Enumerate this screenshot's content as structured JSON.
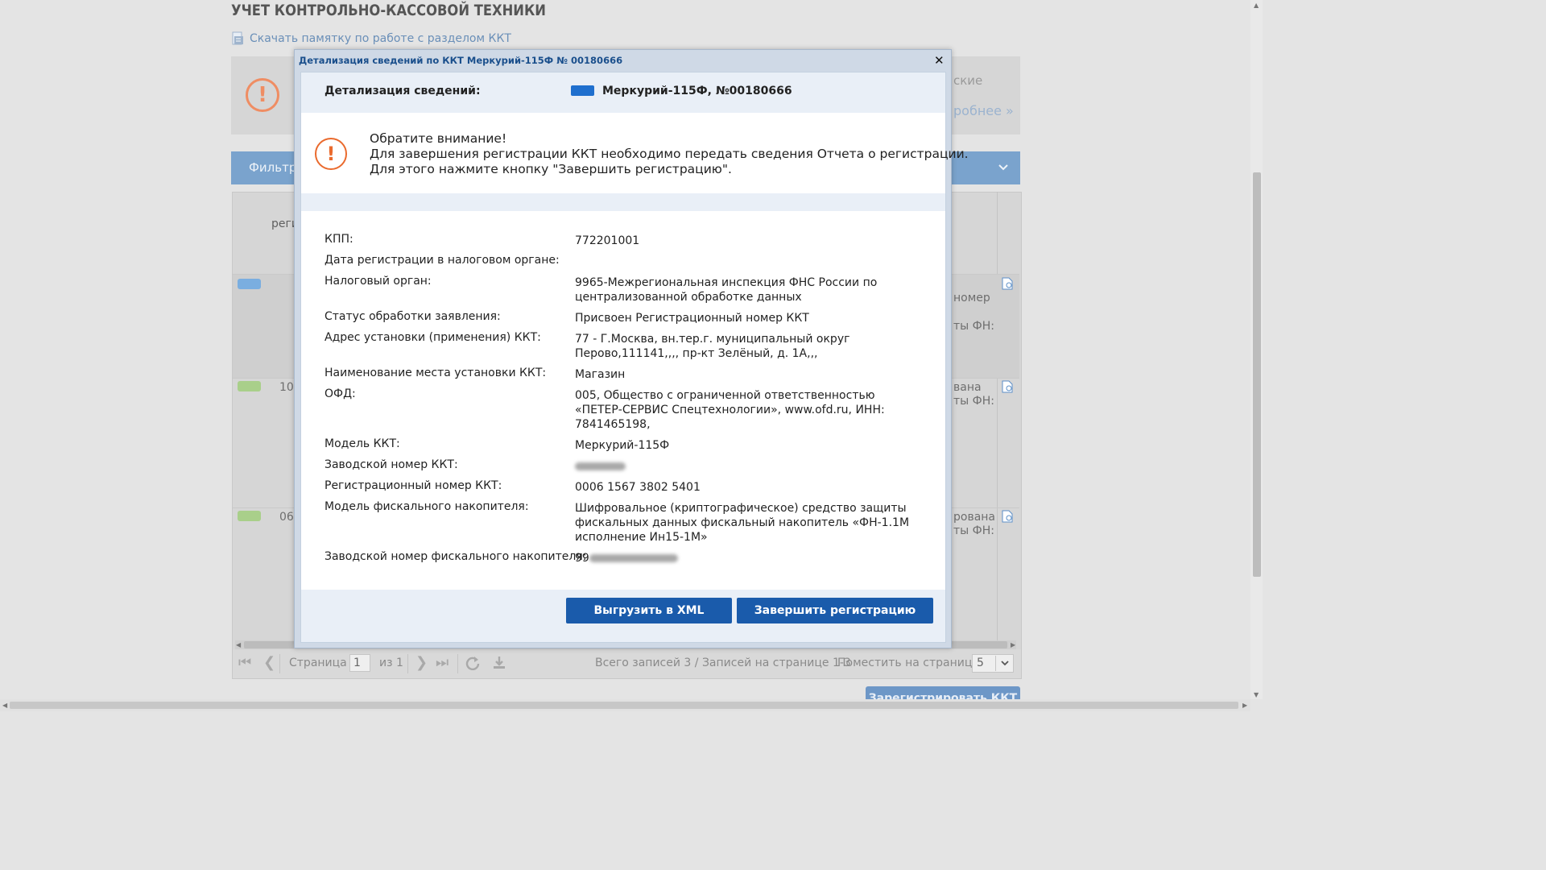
{
  "page": {
    "title": "УЧЕТ КОНТРОЛЬНО-КАССОВОЙ ТЕХНИКИ",
    "memo_link": "Скачать памятку по работе с разделом ККТ",
    "notice_fragment_1": "ские",
    "notice_fragment_2": "робнее »",
    "filter_label": "Фильтр",
    "grid_header_label": "реги",
    "rows": [
      {
        "date": "",
        "status_1": "номер",
        "status_2": "ты ФН:",
        "swatch_color": "#7aaee0"
      },
      {
        "date": "10.",
        "status_1": "вана",
        "status_2": "ты ФН:",
        "swatch_color": "#a9cf8a"
      },
      {
        "date": "06.",
        "status_1": "рована",
        "status_2": "ты ФН:",
        "swatch_color": "#a9cf8a"
      }
    ],
    "pager": {
      "first": "⏮",
      "prev": "❮",
      "page_label": "Страница",
      "page_value": "1",
      "of_label": "из 1",
      "next": "❯",
      "last": "⏭",
      "summary": "Всего записей 3 / Записей на странице 1-3",
      "per_page_label": "Поместить на страницу:",
      "per_page_value": "5"
    },
    "register_button": "Зарегистрировать ККТ"
  },
  "modal": {
    "title": "Детализация сведений по ККТ Меркурий-115Ф № 00180666",
    "close_glyph": "✕",
    "section_label": "Детализация сведений:",
    "section_value": "Меркурий-115Ф, №00180666",
    "kkt_color": "#1f6fce",
    "attention": {
      "line1": "Обратите внимание!",
      "line2": "Для завершения регистрации ККТ необходимо передать сведения Отчета о регистрации.",
      "line3": "Для этого нажмите кнопку \"Завершить регистрацию\"."
    },
    "fields": [
      {
        "label": "КПП:",
        "value": [
          "772201001"
        ]
      },
      {
        "label": "Дата регистрации в налоговом органе:",
        "value": [
          ""
        ]
      },
      {
        "label": "Налоговый орган:",
        "value": [
          "9965-Межрегиональная инспекция ФНС России по",
          "централизованной обработке данных"
        ]
      },
      {
        "label": "Статус обработки заявления:",
        "value": [
          "Присвоен Регистрационный номер ККТ"
        ]
      },
      {
        "label": "Адрес установки (применения) ККТ:",
        "value": [
          "77 - Г.Москва, вн.тер.г. муниципальный округ",
          "Перово,111141,,,, пр-кт Зелёный, д. 1А,,,"
        ]
      },
      {
        "label": "Наименование места установки ККТ:",
        "value": [
          "Магазин"
        ]
      },
      {
        "label": "ОФД:",
        "value": [
          "005, Общество с ограниченной ответственностью",
          "«ПЕТЕР-СЕРВИС Спецтехнологии», www.ofd.ru, ИНН:",
          "7841465198,"
        ]
      },
      {
        "label": "Модель ККТ:",
        "value": [
          "Меркурий-115Ф"
        ]
      },
      {
        "label": "Заводской номер ККТ:",
        "value": [
          ""
        ]
      },
      {
        "label": "Регистрационный номер ККТ:",
        "value": [
          "0006 1567 3802 5401"
        ]
      },
      {
        "label": "Модель фискального накопителя:",
        "value": [
          "Шифровальное (криптографическое) средство защиты",
          "фискальных данных фискальный накопитель «ФН-1.1М",
          "исполнение Ин15-1М»"
        ]
      },
      {
        "label": "Заводской номер фискального накопителя:",
        "value": [
          "99"
        ]
      }
    ],
    "buttons": {
      "export_xml": "Выгрузить в XML",
      "finish_registration": "Завершить регистрацию"
    }
  }
}
